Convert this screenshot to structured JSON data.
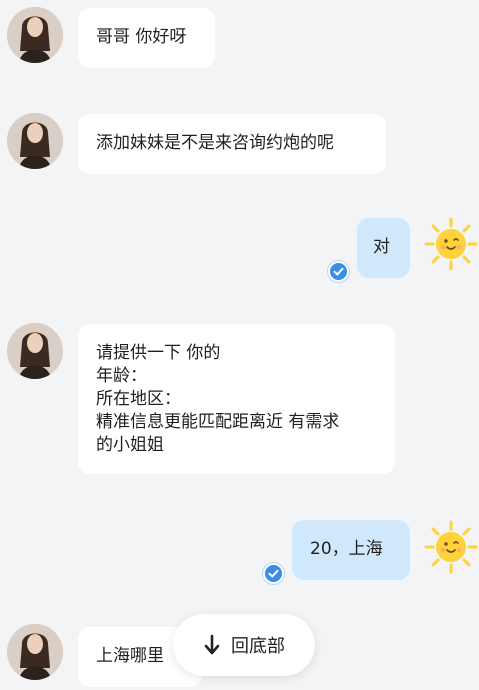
{
  "messages": [
    {
      "side": "left",
      "lines": [
        "哥哥 你好呀"
      ]
    },
    {
      "side": "left",
      "lines": [
        "添加妹妹是不是来咨询约炮的呢"
      ]
    },
    {
      "side": "right",
      "lines": [
        "对"
      ]
    },
    {
      "side": "left",
      "lines": [
        "请提供一下 你的",
        "年龄：",
        "所在地区：",
        "精准信息更能匹配距离近 有需求",
        "的小姐姐"
      ]
    },
    {
      "side": "right",
      "lines": [
        "20，上海"
      ]
    },
    {
      "side": "left",
      "lines": [
        "上海哪里"
      ]
    }
  ],
  "scroll_button": {
    "label": "回底部",
    "icon": "arrow-down-icon"
  },
  "icons": {
    "avatar": "user-avatar",
    "sun": "sun-avatar-icon",
    "read_receipt": "read-check-icon"
  },
  "colors": {
    "background": "#f3f4f6",
    "left_bubble": "#ffffff",
    "right_bubble": "#cfe8fb",
    "check": "#3a8ee6",
    "sun": "#ffd23a"
  }
}
